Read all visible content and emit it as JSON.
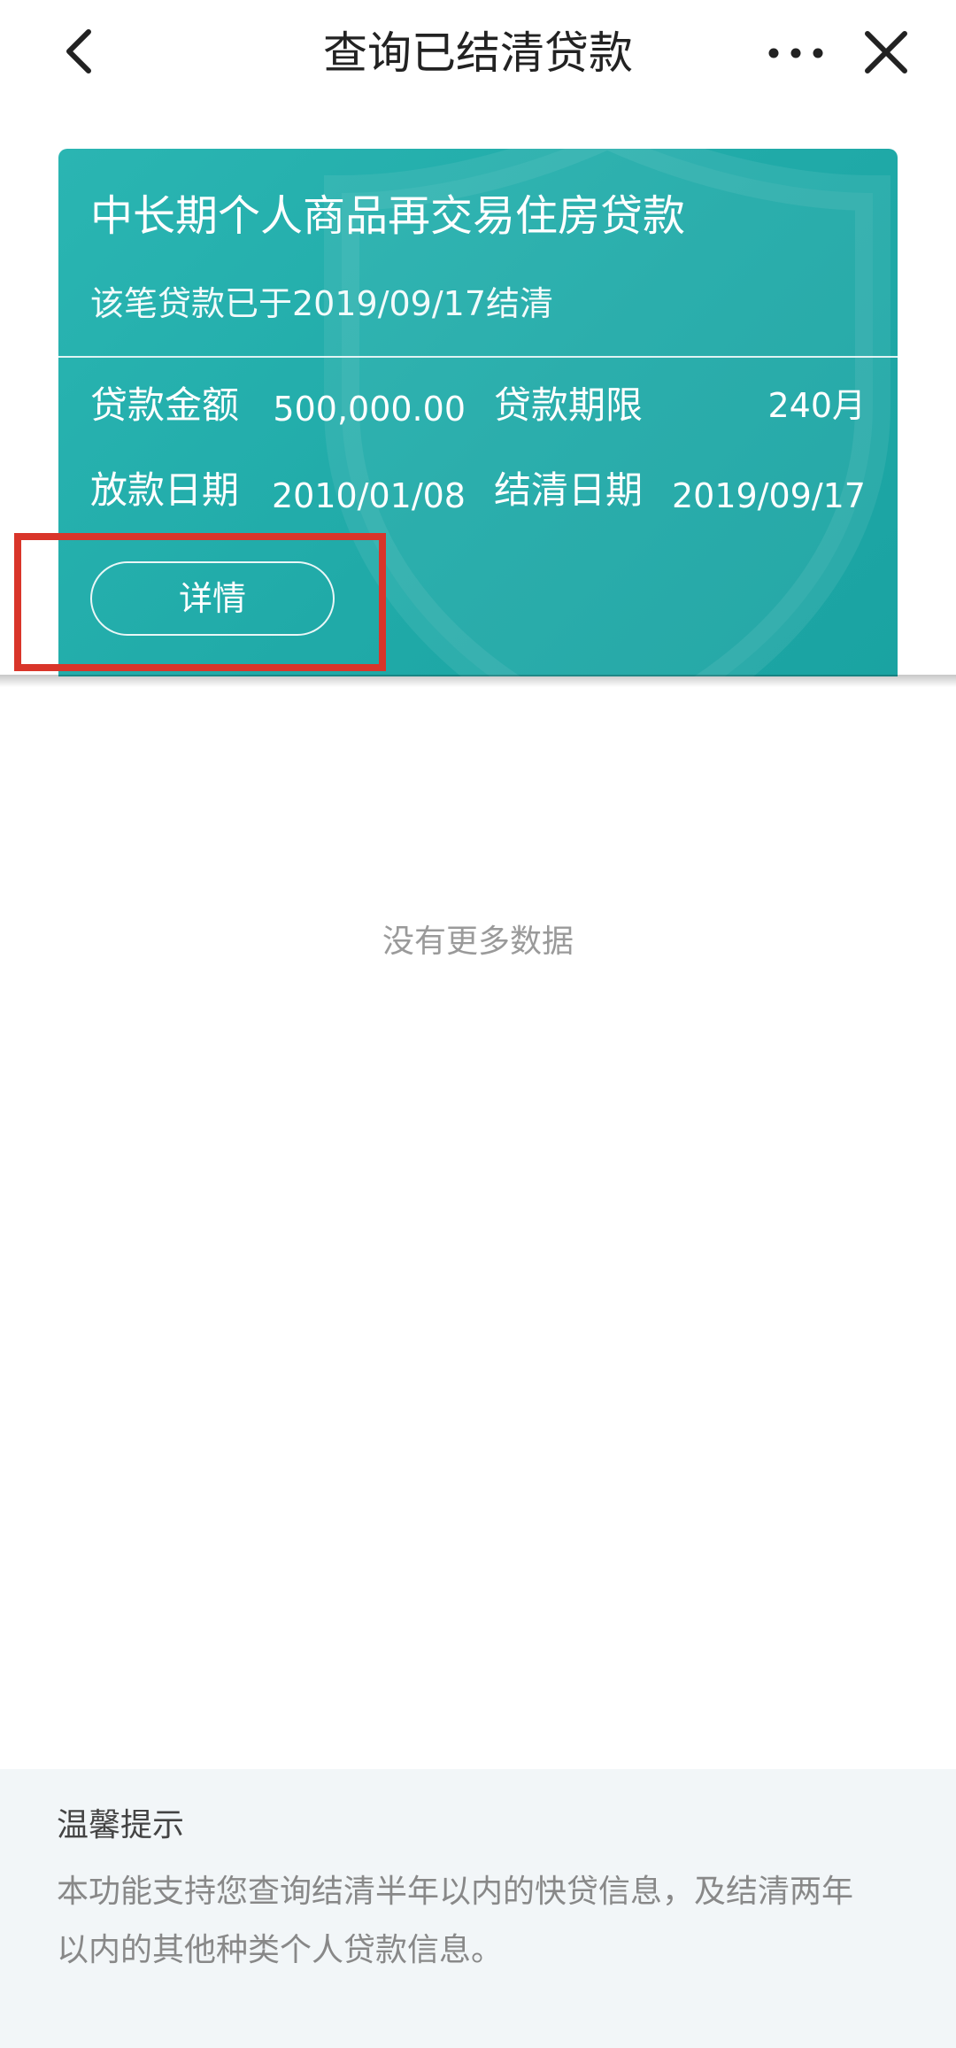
{
  "header": {
    "title": "查询已结清贷款",
    "back_icon": "chevron-left-icon",
    "more_icon": "more-horizontal-icon",
    "close_icon": "close-icon"
  },
  "loan_card": {
    "name": "中长期个人商品再交易住房贷款",
    "settled_note": "该笔贷款已于2019/09/17结清",
    "fields": [
      {
        "label": "贷款金额",
        "value": "500,000.00"
      },
      {
        "label": "贷款期限",
        "value": "240月"
      },
      {
        "label": "放款日期",
        "value": "2010/01/08"
      },
      {
        "label": "结清日期",
        "value": "2019/09/17"
      }
    ],
    "detail_button": "详情",
    "background_color": "#22aeac"
  },
  "empty_message": "没有更多数据",
  "tips": {
    "title": "温馨提示",
    "body_line1": "本功能支持您查询结清半年以内的快贷信息，及结清两年",
    "body_line2": "以内的其他种类个人贷款信息。"
  },
  "annotation": {
    "highlight_color": "#d9352a"
  }
}
